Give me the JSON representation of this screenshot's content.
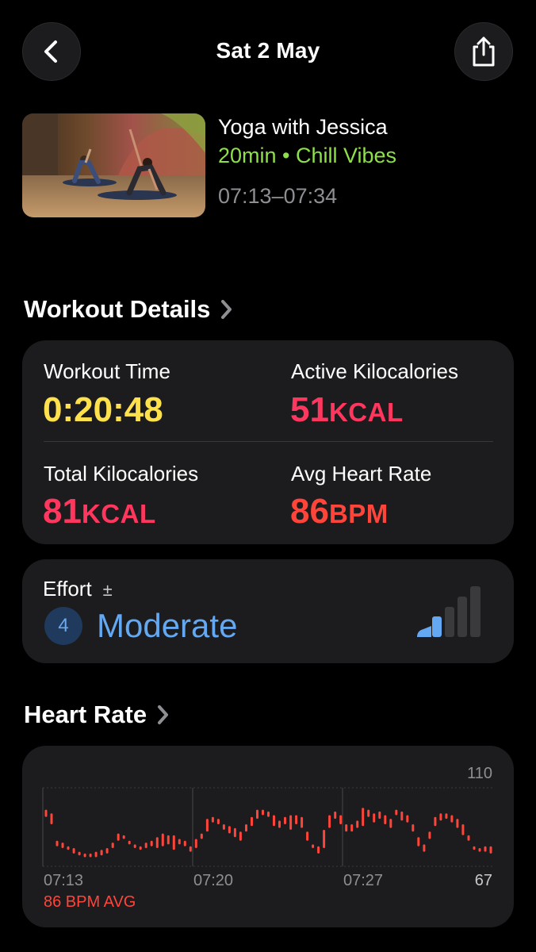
{
  "header": {
    "title": "Sat 2 May"
  },
  "workout": {
    "title": "Yoga with Jessica",
    "subtitle": "20min • Chill Vibes",
    "time_range": "07:13–07:34"
  },
  "details": {
    "section_title": "Workout Details",
    "metrics": [
      {
        "label": "Workout Time",
        "value": "0:20:48",
        "unit": "",
        "color": "#ffe14d"
      },
      {
        "label": "Active Kilocalories",
        "value": "51",
        "unit": "KCAL",
        "color": "#ff375f"
      },
      {
        "label": "Total Kilocalories",
        "value": "81",
        "unit": "KCAL",
        "color": "#ff375f"
      },
      {
        "label": "Avg Heart Rate",
        "value": "86",
        "unit": "BPM",
        "color": "#ff453a"
      }
    ]
  },
  "effort": {
    "label": "Effort",
    "adjust_symbol": "±",
    "level_number": "4",
    "level_text": "Moderate",
    "color": "#64a8f2",
    "bars_filled": 2,
    "bars_total": 5
  },
  "heart_rate": {
    "section_title": "Heart Rate",
    "max_label": "110",
    "min_label": "67",
    "avg_label": "86 BPM AVG",
    "time_labels": [
      "07:13",
      "07:20",
      "07:27"
    ],
    "color": "#ff453a"
  },
  "chart_data": {
    "type": "bar",
    "ylim": [
      67,
      110
    ],
    "x_ticks": [
      "07:13",
      "07:20",
      "07:27"
    ],
    "series": [
      {
        "ranges": [
          [
            94,
            98
          ],
          [
            90,
            96
          ],
          [
            78,
            81
          ],
          [
            77,
            80
          ],
          [
            76,
            78
          ],
          [
            74,
            77
          ],
          [
            73,
            75
          ],
          [
            72,
            74
          ],
          [
            72,
            74
          ],
          [
            72,
            75
          ],
          [
            73,
            76
          ],
          [
            74,
            77
          ],
          [
            77,
            80
          ],
          [
            81,
            85
          ],
          [
            82,
            84
          ],
          [
            79,
            81
          ],
          [
            77,
            79
          ],
          [
            76,
            78
          ],
          [
            77,
            80
          ],
          [
            78,
            81
          ],
          [
            77,
            83
          ],
          [
            78,
            85
          ],
          [
            79,
            84
          ],
          [
            76,
            84
          ],
          [
            79,
            82
          ],
          [
            78,
            81
          ],
          [
            75,
            78
          ],
          [
            77,
            82
          ],
          [
            82,
            85
          ],
          [
            86,
            93
          ],
          [
            91,
            94
          ],
          [
            90,
            93
          ],
          [
            87,
            90
          ],
          [
            85,
            89
          ],
          [
            83,
            88
          ],
          [
            81,
            86
          ],
          [
            86,
            90
          ],
          [
            89,
            94
          ],
          [
            93,
            98
          ],
          [
            95,
            98
          ],
          [
            94,
            97
          ],
          [
            89,
            95
          ],
          [
            88,
            92
          ],
          [
            90,
            94
          ],
          [
            87,
            95
          ],
          [
            90,
            95
          ],
          [
            88,
            94
          ],
          [
            81,
            86
          ],
          [
            77,
            79
          ],
          [
            74,
            78
          ],
          [
            77,
            87
          ],
          [
            88,
            95
          ],
          [
            93,
            97
          ],
          [
            90,
            95
          ],
          [
            86,
            90
          ],
          [
            86,
            90
          ],
          [
            88,
            92
          ],
          [
            89,
            99
          ],
          [
            94,
            98
          ],
          [
            91,
            96
          ],
          [
            93,
            97
          ],
          [
            90,
            95
          ],
          [
            88,
            93
          ],
          [
            95,
            98
          ],
          [
            92,
            97
          ],
          [
            91,
            95
          ],
          [
            86,
            90
          ],
          [
            78,
            83
          ],
          [
            75,
            79
          ],
          [
            82,
            86
          ],
          [
            89,
            94
          ],
          [
            92,
            96
          ],
          [
            93,
            96
          ],
          [
            91,
            95
          ],
          [
            88,
            93
          ],
          [
            84,
            90
          ],
          [
            81,
            84
          ],
          [
            76,
            78
          ],
          [
            75,
            77
          ],
          [
            75,
            78
          ],
          [
            74,
            78
          ]
        ]
      }
    ]
  }
}
